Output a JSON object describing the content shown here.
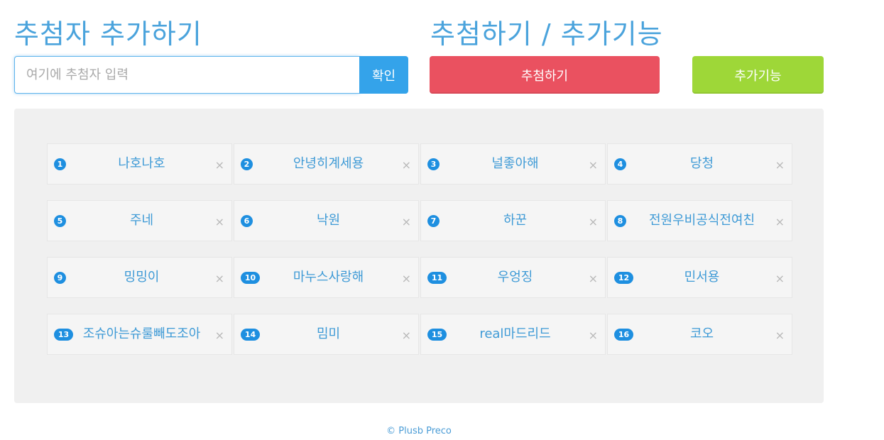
{
  "left_title": "추첨자 추가하기",
  "right_title": "추첨하기 / 추가기능",
  "input": {
    "placeholder": "여기에 추첨자 입력",
    "value": ""
  },
  "buttons": {
    "confirm": "확인",
    "draw": "추첨하기",
    "extra": "추가기능"
  },
  "participants": [
    {
      "num": "1",
      "name": "나호나호"
    },
    {
      "num": "2",
      "name": "안녕히계세용"
    },
    {
      "num": "3",
      "name": "널좋아해"
    },
    {
      "num": "4",
      "name": "당청"
    },
    {
      "num": "5",
      "name": "주네"
    },
    {
      "num": "6",
      "name": "낙원"
    },
    {
      "num": "7",
      "name": "하꾼"
    },
    {
      "num": "8",
      "name": "전원우비공식전여친"
    },
    {
      "num": "9",
      "name": "밍밍이"
    },
    {
      "num": "10",
      "name": "마누스사랑해"
    },
    {
      "num": "11",
      "name": "우엉징"
    },
    {
      "num": "12",
      "name": "민서용"
    },
    {
      "num": "13",
      "name": "조슈아는슈룰빼도조아"
    },
    {
      "num": "14",
      "name": "밈미"
    },
    {
      "num": "15",
      "name": "real마드리드"
    },
    {
      "num": "16",
      "name": "코오"
    }
  ],
  "remove_icon": "×",
  "footer": "© Plusb Preco",
  "colors": {
    "title": "#4aa3dc",
    "confirm": "#34a3ea",
    "draw": "#ea5160",
    "extra": "#9ed738",
    "badge": "#1e8fe0",
    "name": "#3e9ad6"
  }
}
